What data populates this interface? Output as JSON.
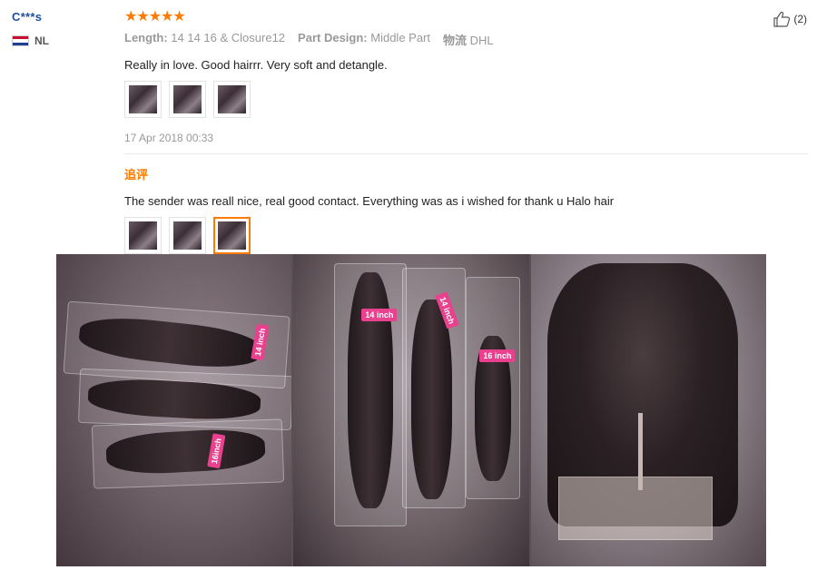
{
  "reviewer": {
    "name": "C***s",
    "country_code": "NL",
    "flag_icon": "netherlands-flag-icon"
  },
  "review": {
    "stars": "★★★★★",
    "rating": 5,
    "attributes": [
      {
        "key": "Length:",
        "value": "14 14 16 & Closure12"
      },
      {
        "key": "Part Design:",
        "value": "Middle Part"
      },
      {
        "key": "物流",
        "value": "DHL"
      }
    ],
    "text": "Really in love. Good hairrr. Very soft and detangle.",
    "date": "17 Apr 2018 00:33"
  },
  "followup": {
    "label": "追评",
    "text": "The sender was reall nice, real good contact. Everything was as i wished for thank u Halo hair"
  },
  "helpful": {
    "count": "(2)",
    "icon": "thumbs-up-icon"
  },
  "photo_labels": {
    "tag_14_a": "14 inch",
    "tag_14_b": "14 inch",
    "tag_16": "16 inch",
    "tag_p1a": "14 inch",
    "tag_p1b": "16inch"
  },
  "colors": {
    "accent": "#ff7a00",
    "username": "#1f4e9c",
    "tag_pink": "#e9418d"
  }
}
